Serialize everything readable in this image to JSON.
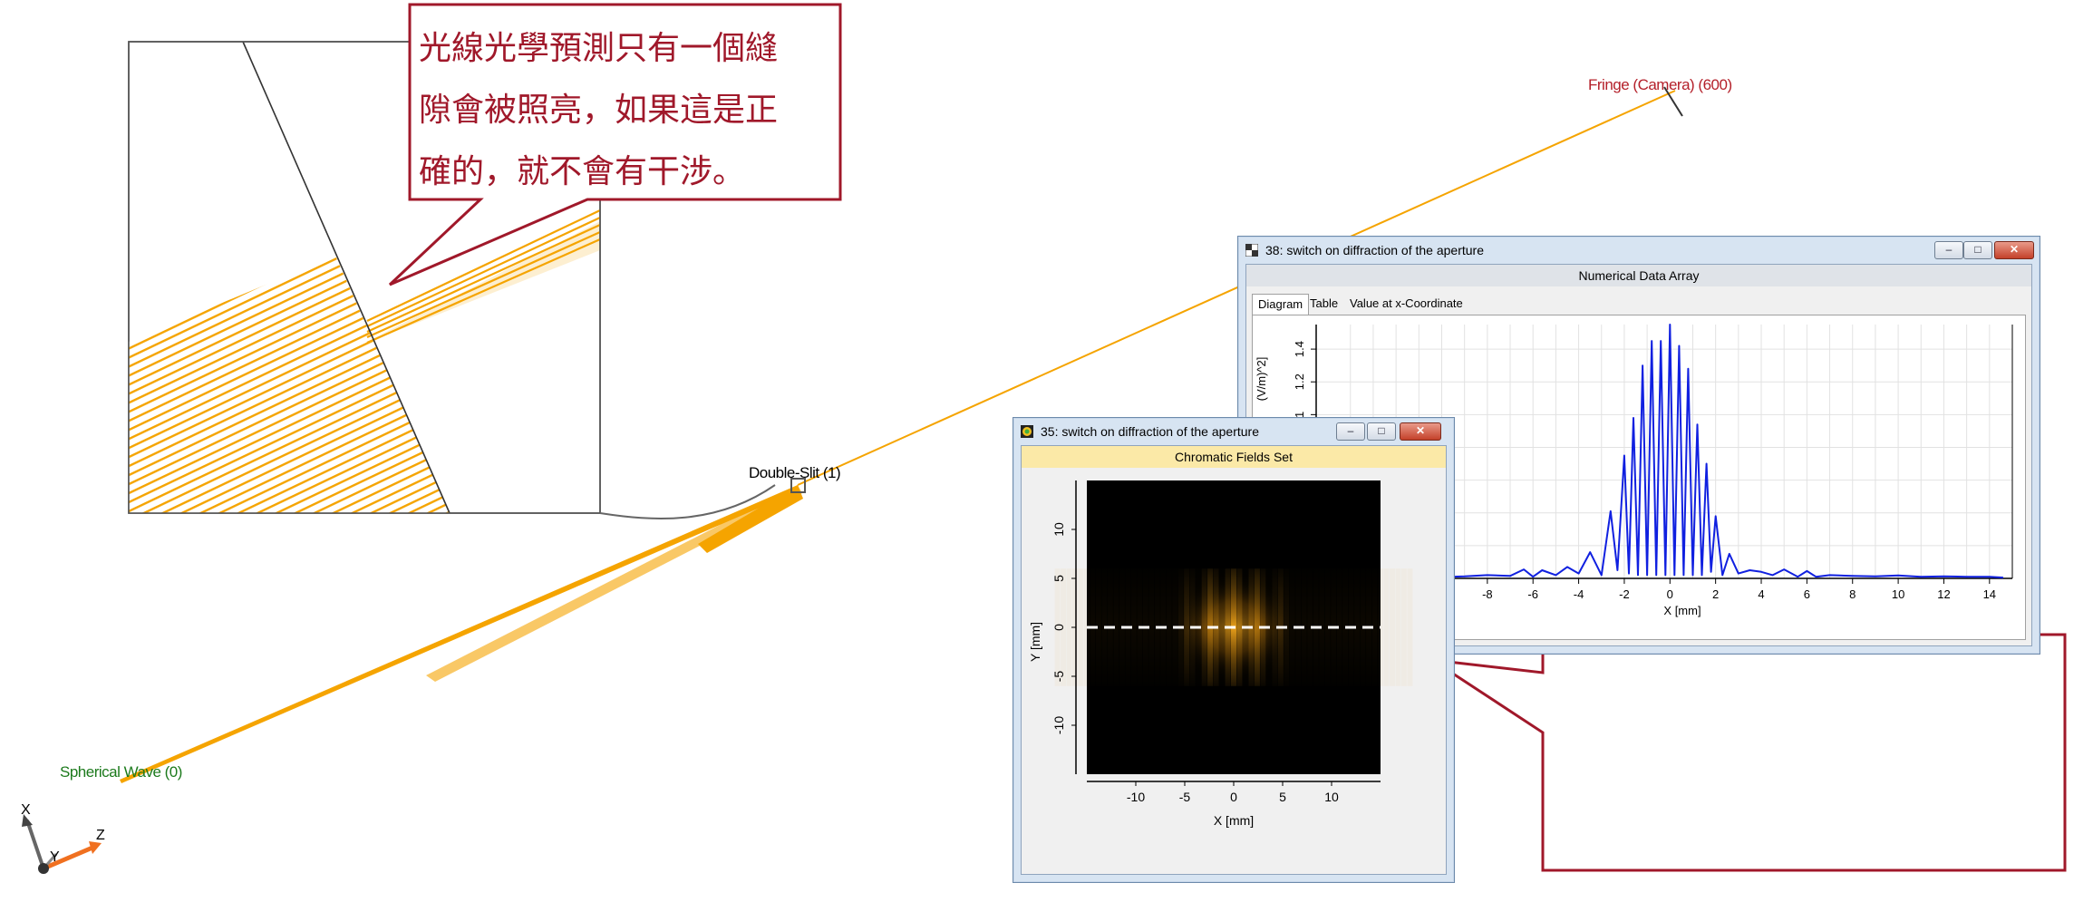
{
  "callout_top": {
    "lines": [
      "光線光學預測只有一個縫",
      "隙會被照亮，如果這是正",
      "確的，就不會有干涉。"
    ]
  },
  "labels": {
    "fringe": "Fringe (Camera) (600)",
    "double_slit": "Double-Slit (1)",
    "spherical_wave": "Spherical Wave (0)"
  },
  "axes_triad": {
    "x": "X",
    "y": "Y",
    "z": "Z"
  },
  "window_38": {
    "title": "38: switch on diffraction of the aperture",
    "subheader": "Numerical Data Array",
    "tabs": [
      "Diagram",
      "Table",
      "Value at x-Coordinate"
    ],
    "active_tab": "Diagram",
    "window_buttons": {
      "minimize": "–",
      "restore": "□",
      "close": "✕"
    }
  },
  "window_35": {
    "title": "35: switch on diffraction of the aperture",
    "subheader": "Chromatic Fields Set",
    "window_buttons": {
      "minimize": "–",
      "restore": "□",
      "close": "✕"
    }
  },
  "colors": {
    "ray": "#f5a400",
    "callout_border": "#a0182a",
    "fringe_label": "#b4202a",
    "spherical_label": "#1c7a1c",
    "curve": "#1020e0",
    "subheader_yellow": "#fbe9a7"
  },
  "chart_data": [
    {
      "type": "line",
      "xlabel": "X [mm]",
      "ylabel": "(V/m)^2]",
      "xlim": [
        -15.5,
        15
      ],
      "ylim": [
        0,
        1.55
      ],
      "x_ticks": [
        -8,
        -6,
        -4,
        -2,
        0,
        2,
        4,
        6,
        8,
        10,
        12,
        14
      ],
      "y_ticks": [
        1,
        1.2,
        1.4
      ],
      "grid": true,
      "series": [
        {
          "x": [
            -9.6,
            -9,
            -8,
            -7,
            -6.4,
            -6,
            -5.6,
            -5,
            -4.5,
            -4,
            -3.5,
            -3,
            -2.6,
            -2.3,
            -2,
            -1.8,
            -1.6,
            -1.4,
            -1.2,
            -1,
            -0.8,
            -0.6,
            -0.4,
            -0.2,
            0,
            0.2,
            0.4,
            0.6,
            0.8,
            1,
            1.2,
            1.4,
            1.6,
            1.8,
            2,
            2.3,
            2.6,
            3,
            3.5,
            4,
            4.5,
            5,
            5.6,
            6,
            6.4,
            7,
            8,
            9,
            10,
            11,
            12,
            13,
            14,
            14.6
          ],
          "values": [
            0.01,
            0.012,
            0.02,
            0.015,
            0.055,
            0.01,
            0.05,
            0.02,
            0.07,
            0.03,
            0.16,
            0.02,
            0.41,
            0.05,
            0.75,
            0.03,
            0.98,
            0.02,
            1.3,
            0.02,
            1.45,
            0.02,
            1.45,
            0.02,
            1.55,
            0.02,
            1.42,
            0.02,
            1.28,
            0.02,
            0.94,
            0.02,
            0.7,
            0.04,
            0.38,
            0.02,
            0.15,
            0.03,
            0.05,
            0.04,
            0.02,
            0.055,
            0.01,
            0.045,
            0.01,
            0.02,
            0.015,
            0.012,
            0.018,
            0.01,
            0.012,
            0.01,
            0.01,
            0.005
          ]
        }
      ]
    },
    {
      "type": "heatmap",
      "xlabel": "X [mm]",
      "ylabel": "Y [mm]",
      "xlim": [
        -15,
        15
      ],
      "ylim": [
        -15,
        15
      ],
      "x_ticks": [
        -10,
        -5,
        0,
        5,
        10
      ],
      "y_ticks": [
        10,
        5,
        0,
        -5,
        -10
      ],
      "y_tick_labels": [
        "10",
        "5",
        "0",
        "-5",
        "-10"
      ],
      "cross_section_y": 0
    }
  ]
}
